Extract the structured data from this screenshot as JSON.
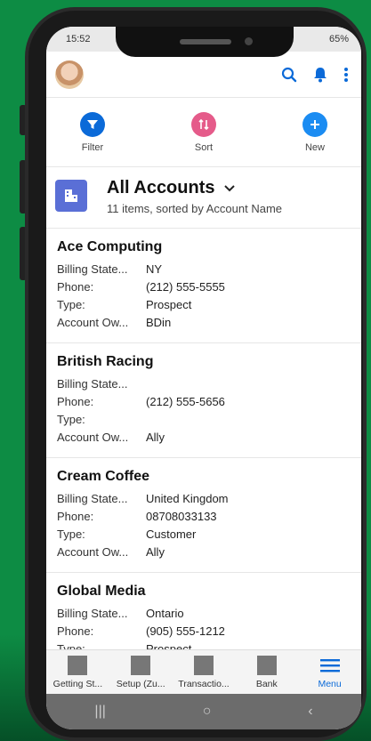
{
  "status": {
    "time": "15:52",
    "battery": "65%"
  },
  "actions": [
    {
      "label": "Filter",
      "color": "#0b6ad8",
      "icon": "filter-icon"
    },
    {
      "label": "Sort",
      "color": "#e55b8a",
      "icon": "sort-icon"
    },
    {
      "label": "New",
      "color": "#1b8cf2",
      "icon": "plus-icon"
    }
  ],
  "list": {
    "title": "All Accounts",
    "subtitle": "11 items, sorted by Account Name"
  },
  "records": [
    {
      "name": "Ace Computing",
      "fields": [
        {
          "label": "Billing State...",
          "value": "NY"
        },
        {
          "label": "Phone:",
          "value": "(212) 555-5555"
        },
        {
          "label": "Type:",
          "value": "Prospect"
        },
        {
          "label": "Account Ow...",
          "value": "BDin"
        }
      ]
    },
    {
      "name": "British Racing",
      "fields": [
        {
          "label": "Billing State...",
          "value": ""
        },
        {
          "label": "Phone:",
          "value": "(212) 555-5656"
        },
        {
          "label": "Type:",
          "value": ""
        },
        {
          "label": "Account Ow...",
          "value": "Ally"
        }
      ]
    },
    {
      "name": "Cream Coffee",
      "fields": [
        {
          "label": "Billing State...",
          "value": "United Kingdom"
        },
        {
          "label": "Phone:",
          "value": "08708033133"
        },
        {
          "label": "Type:",
          "value": "Customer"
        },
        {
          "label": "Account Ow...",
          "value": "Ally"
        }
      ]
    },
    {
      "name": "Global Media",
      "fields": [
        {
          "label": "Billing State...",
          "value": "Ontario"
        },
        {
          "label": "Phone:",
          "value": "(905) 555-1212"
        },
        {
          "label": "Type:",
          "value": "Prospect"
        }
      ]
    }
  ],
  "tabs": [
    {
      "label": "Getting St...",
      "active": false
    },
    {
      "label": "Setup (Zu...",
      "active": false
    },
    {
      "label": "Transactio...",
      "active": false
    },
    {
      "label": "Bank",
      "active": false
    },
    {
      "label": "Menu",
      "active": true
    }
  ],
  "nav": [
    "|||",
    "○",
    "‹"
  ]
}
